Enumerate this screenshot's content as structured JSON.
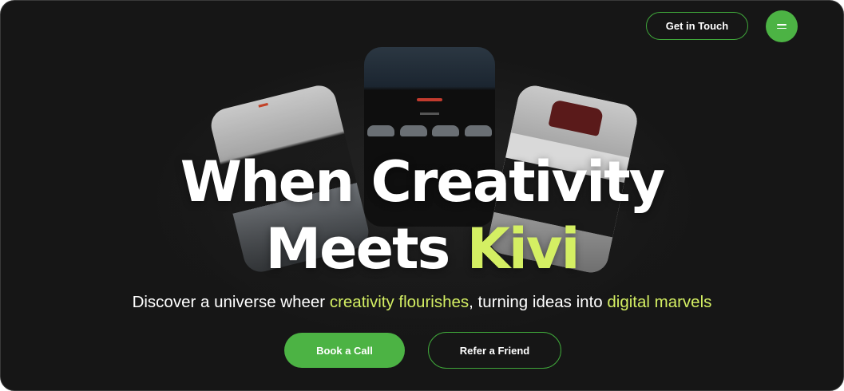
{
  "header": {
    "cta_label": "Get in Touch",
    "menu_icon": "hamburger-menu-icon"
  },
  "hero": {
    "title_line1": "When Creativity",
    "title_line2_prefix": "Meets ",
    "title_line2_accent": "Kivi",
    "subtitle_part1": "Discover a universe wheer ",
    "subtitle_accent1": "creativity flourishes",
    "subtitle_part2": ", turning ideas into ",
    "subtitle_accent2": "digital marvels",
    "primary_button": "Book a Call",
    "secondary_button": "Refer a Friend"
  },
  "colors": {
    "background": "#161616",
    "brand_green": "#4cb344",
    "accent_lime": "#d4ef63",
    "text": "#ffffff"
  }
}
